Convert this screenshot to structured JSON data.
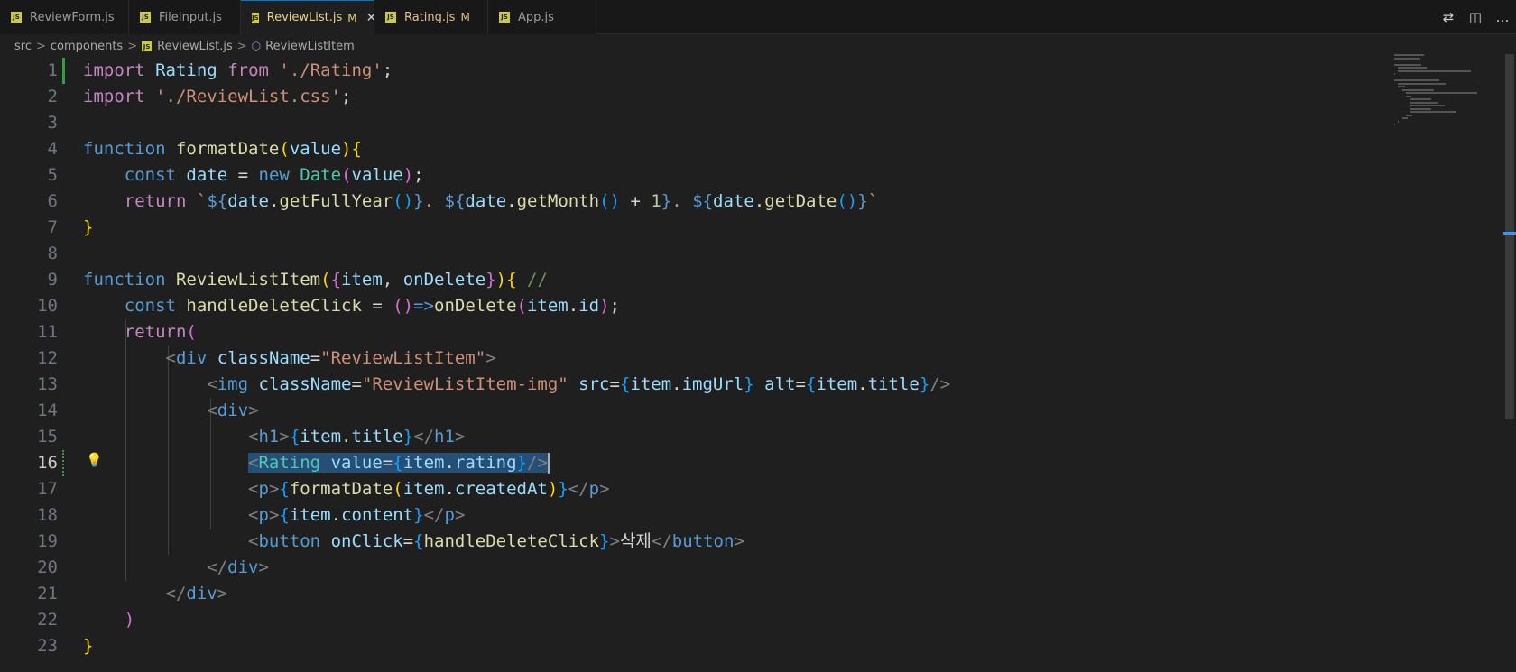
{
  "tabs": [
    {
      "label": "ReviewForm.js",
      "badge": "",
      "active": false
    },
    {
      "label": "FileInput.js",
      "badge": "",
      "active": false
    },
    {
      "label": "ReviewList.js",
      "badge": "M",
      "active": true
    },
    {
      "label": "Rating.js",
      "badge": "M",
      "active": false
    },
    {
      "label": "App.js",
      "badge": "",
      "active": false
    }
  ],
  "tab_icon_text": "JS",
  "close_glyph": "✕",
  "breadcrumb": {
    "parts": [
      "src",
      "components",
      "ReviewList.js",
      "ReviewListItem"
    ],
    "sep": ">"
  },
  "actions": [
    {
      "icon": "git-compare-icon",
      "glyph": "⇄"
    },
    {
      "icon": "split-editor-icon",
      "glyph": "◫"
    },
    {
      "icon": "more-actions-icon",
      "glyph": "…"
    }
  ],
  "editor": {
    "current_line": 16,
    "line_numbers": [
      "1",
      "2",
      "3",
      "4",
      "5",
      "6",
      "7",
      "8",
      "9",
      "10",
      "11",
      "12",
      "13",
      "14",
      "15",
      "16",
      "17",
      "18",
      "19",
      "20",
      "21",
      "22",
      "23"
    ],
    "lines": [
      [
        [
          "kw2",
          "import"
        ],
        [
          "txt",
          " "
        ],
        [
          "var",
          "Rating"
        ],
        [
          "txt",
          " "
        ],
        [
          "kw2",
          "from"
        ],
        [
          "txt",
          " "
        ],
        [
          "str",
          "'./Rating'"
        ],
        [
          "txt",
          ";"
        ]
      ],
      [
        [
          "kw2",
          "import"
        ],
        [
          "txt",
          " "
        ],
        [
          "str",
          "'./ReviewList.css'"
        ],
        [
          "txt",
          ";"
        ]
      ],
      [],
      [
        [
          "kw",
          "function"
        ],
        [
          "txt",
          " "
        ],
        [
          "fn",
          "formatDate"
        ],
        [
          "br1",
          "("
        ],
        [
          "var",
          "value"
        ],
        [
          "br1",
          ")"
        ],
        [
          "br1",
          "{"
        ]
      ],
      [
        [
          "txt",
          "    "
        ],
        [
          "kw",
          "const"
        ],
        [
          "txt",
          " "
        ],
        [
          "var",
          "date"
        ],
        [
          "txt",
          " = "
        ],
        [
          "kw",
          "new"
        ],
        [
          "txt",
          " "
        ],
        [
          "cls",
          "Date"
        ],
        [
          "br2",
          "("
        ],
        [
          "var",
          "value"
        ],
        [
          "br2",
          ")"
        ],
        [
          "txt",
          ";"
        ]
      ],
      [
        [
          "txt",
          "    "
        ],
        [
          "kw2",
          "return"
        ],
        [
          "txt",
          " "
        ],
        [
          "str",
          "`"
        ],
        [
          "kw",
          "${"
        ],
        [
          "var",
          "date"
        ],
        [
          "txt",
          "."
        ],
        [
          "fn",
          "getFullYear"
        ],
        [
          "br3",
          "()"
        ],
        [
          "kw",
          "}"
        ],
        [
          "str",
          ". "
        ],
        [
          "kw",
          "${"
        ],
        [
          "var",
          "date"
        ],
        [
          "txt",
          "."
        ],
        [
          "fn",
          "getMonth"
        ],
        [
          "br3",
          "()"
        ],
        [
          "txt",
          " + "
        ],
        [
          "num",
          "1"
        ],
        [
          "kw",
          "}"
        ],
        [
          "str",
          ". "
        ],
        [
          "kw",
          "${"
        ],
        [
          "var",
          "date"
        ],
        [
          "txt",
          "."
        ],
        [
          "fn",
          "getDate"
        ],
        [
          "br3",
          "()"
        ],
        [
          "kw",
          "}"
        ],
        [
          "str",
          "`"
        ]
      ],
      [
        [
          "br1",
          "}"
        ]
      ],
      [],
      [
        [
          "kw",
          "function"
        ],
        [
          "txt",
          " "
        ],
        [
          "fn",
          "ReviewListItem"
        ],
        [
          "br1",
          "("
        ],
        [
          "br2",
          "{"
        ],
        [
          "var",
          "item"
        ],
        [
          "txt",
          ", "
        ],
        [
          "var",
          "onDelete"
        ],
        [
          "br2",
          "}"
        ],
        [
          "br1",
          ")"
        ],
        [
          "br1",
          "{"
        ],
        [
          "txt",
          " "
        ],
        [
          "cm",
          "//"
        ]
      ],
      [
        [
          "txt",
          "    "
        ],
        [
          "kw",
          "const"
        ],
        [
          "txt",
          " "
        ],
        [
          "fn",
          "handleDeleteClick"
        ],
        [
          "txt",
          " = "
        ],
        [
          "br2",
          "()"
        ],
        [
          "kw",
          "=>"
        ],
        [
          "fn",
          "onDelete"
        ],
        [
          "br2",
          "("
        ],
        [
          "var",
          "item"
        ],
        [
          "txt",
          "."
        ],
        [
          "var",
          "id"
        ],
        [
          "br2",
          ")"
        ],
        [
          "txt",
          ";"
        ]
      ],
      [
        [
          "txt",
          "    "
        ],
        [
          "kw2",
          "return"
        ],
        [
          "br2",
          "("
        ]
      ],
      [
        [
          "txt",
          "        "
        ],
        [
          "tag",
          "<"
        ],
        [
          "tn",
          "div"
        ],
        [
          "txt",
          " "
        ],
        [
          "attr",
          "className"
        ],
        [
          "txt",
          "="
        ],
        [
          "str",
          "\"ReviewListItem\""
        ],
        [
          "tag",
          ">"
        ]
      ],
      [
        [
          "txt",
          "            "
        ],
        [
          "tag",
          "<"
        ],
        [
          "tn",
          "img"
        ],
        [
          "txt",
          " "
        ],
        [
          "attr",
          "className"
        ],
        [
          "txt",
          "="
        ],
        [
          "str",
          "\"ReviewListItem-img\""
        ],
        [
          "txt",
          " "
        ],
        [
          "attr",
          "src"
        ],
        [
          "txt",
          "="
        ],
        [
          "br3",
          "{"
        ],
        [
          "var",
          "item"
        ],
        [
          "txt",
          "."
        ],
        [
          "var",
          "imgUrl"
        ],
        [
          "br3",
          "}"
        ],
        [
          "txt",
          " "
        ],
        [
          "attr",
          "alt"
        ],
        [
          "txt",
          "="
        ],
        [
          "br3",
          "{"
        ],
        [
          "var",
          "item"
        ],
        [
          "txt",
          "."
        ],
        [
          "var",
          "title"
        ],
        [
          "br3",
          "}"
        ],
        [
          "tag",
          "/>"
        ]
      ],
      [
        [
          "txt",
          "            "
        ],
        [
          "tag",
          "<"
        ],
        [
          "tn",
          "div"
        ],
        [
          "tag",
          ">"
        ]
      ],
      [
        [
          "txt",
          "                "
        ],
        [
          "tag",
          "<"
        ],
        [
          "tn",
          "h1"
        ],
        [
          "tag",
          ">"
        ],
        [
          "br3",
          "{"
        ],
        [
          "var",
          "item"
        ],
        [
          "txt",
          "."
        ],
        [
          "var",
          "title"
        ],
        [
          "br3",
          "}"
        ],
        [
          "tag",
          "</"
        ],
        [
          "tn",
          "h1"
        ],
        [
          "tag",
          ">"
        ]
      ],
      [
        [
          "txt",
          "                "
        ],
        [
          "sel:tag",
          "<"
        ],
        [
          "sel:cls",
          "Rating"
        ],
        [
          "sel:txt",
          " "
        ],
        [
          "sel:attr",
          "value"
        ],
        [
          "sel:txt",
          "="
        ],
        [
          "sel:br3",
          "{"
        ],
        [
          "sel:var",
          "item"
        ],
        [
          "sel:txt",
          "."
        ],
        [
          "sel:var",
          "rating"
        ],
        [
          "sel:br3",
          "}"
        ],
        [
          "sel:tag",
          "/>"
        ]
      ],
      [
        [
          "txt",
          "                "
        ],
        [
          "tag",
          "<"
        ],
        [
          "tn",
          "p"
        ],
        [
          "tag",
          ">"
        ],
        [
          "br3",
          "{"
        ],
        [
          "fn",
          "formatDate"
        ],
        [
          "br1",
          "("
        ],
        [
          "var",
          "item"
        ],
        [
          "txt",
          "."
        ],
        [
          "var",
          "createdAt"
        ],
        [
          "br1",
          ")"
        ],
        [
          "br3",
          "}"
        ],
        [
          "tag",
          "</"
        ],
        [
          "tn",
          "p"
        ],
        [
          "tag",
          ">"
        ]
      ],
      [
        [
          "txt",
          "                "
        ],
        [
          "tag",
          "<"
        ],
        [
          "tn",
          "p"
        ],
        [
          "tag",
          ">"
        ],
        [
          "br3",
          "{"
        ],
        [
          "var",
          "item"
        ],
        [
          "txt",
          "."
        ],
        [
          "var",
          "content"
        ],
        [
          "br3",
          "}"
        ],
        [
          "tag",
          "</"
        ],
        [
          "tn",
          "p"
        ],
        [
          "tag",
          ">"
        ]
      ],
      [
        [
          "txt",
          "                "
        ],
        [
          "tag",
          "<"
        ],
        [
          "tn",
          "button"
        ],
        [
          "txt",
          " "
        ],
        [
          "attr",
          "onClick"
        ],
        [
          "txt",
          "="
        ],
        [
          "br3",
          "{"
        ],
        [
          "fn",
          "handleDeleteClick"
        ],
        [
          "br3",
          "}"
        ],
        [
          "tag",
          ">"
        ],
        [
          "txt",
          "삭제"
        ],
        [
          "tag",
          "</"
        ],
        [
          "tn",
          "button"
        ],
        [
          "tag",
          ">"
        ]
      ],
      [
        [
          "txt",
          "            "
        ],
        [
          "tag",
          "</"
        ],
        [
          "tn",
          "div"
        ],
        [
          "tag",
          ">"
        ]
      ],
      [
        [
          "txt",
          "        "
        ],
        [
          "tag",
          "</"
        ],
        [
          "tn",
          "div"
        ],
        [
          "tag",
          ">"
        ]
      ],
      [
        [
          "txt",
          "    "
        ],
        [
          "br2",
          ")"
        ]
      ],
      [
        [
          "br1",
          "}"
        ]
      ]
    ]
  },
  "colors": {
    "background": "#1f1f1f",
    "tabbar": "#181818",
    "accent": "#0078d4",
    "selection": "#264f78",
    "git_added": "#2ea043"
  }
}
